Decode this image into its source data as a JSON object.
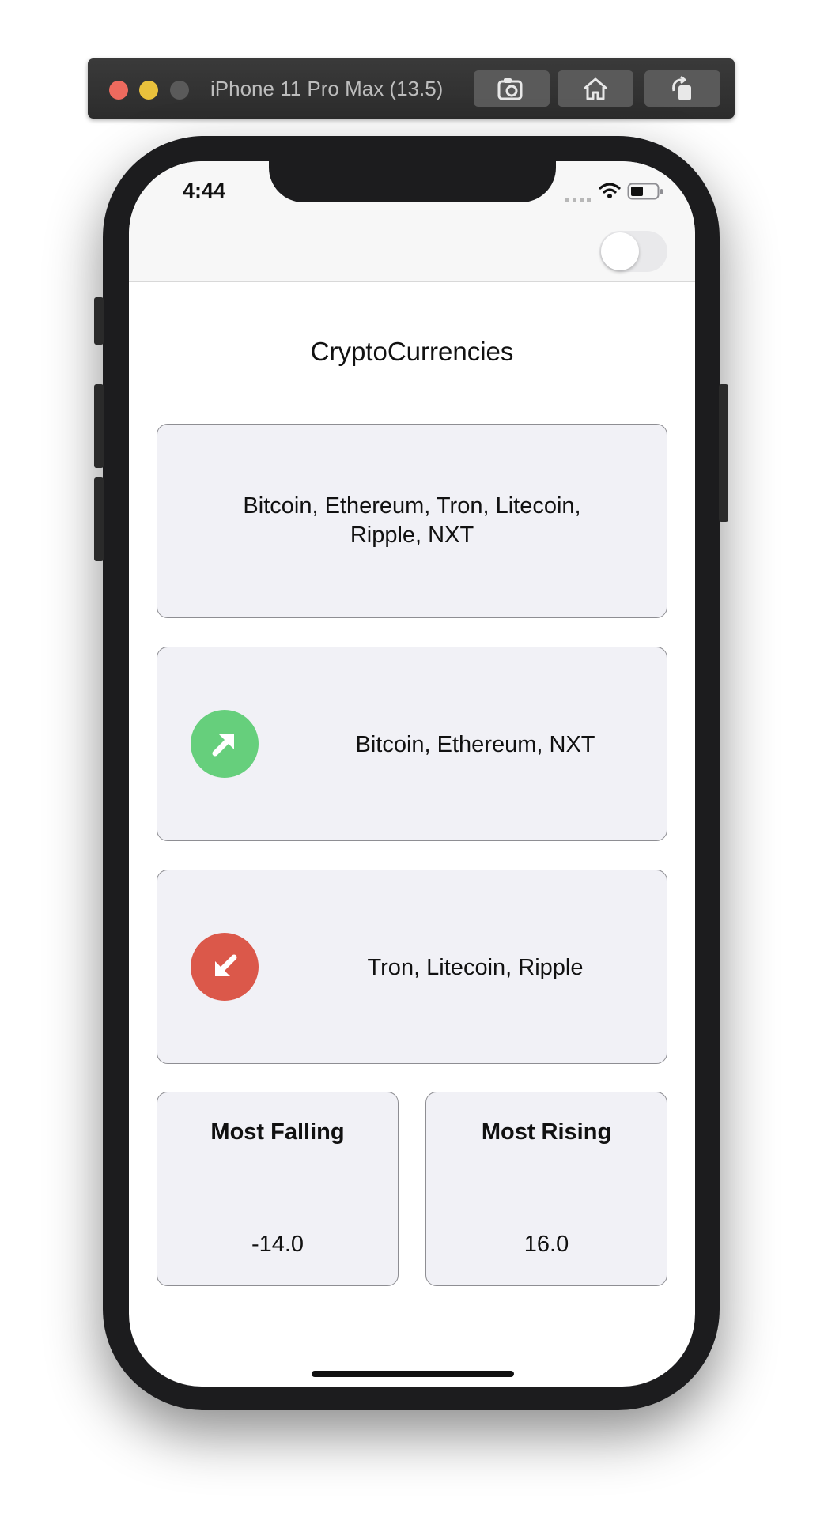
{
  "simulator": {
    "window_title": "iPhone 11 Pro Max (13.5)",
    "buttons": [
      "screenshot-icon",
      "home-icon",
      "rotate-icon"
    ]
  },
  "status_bar": {
    "time": "4:44"
  },
  "toggle": {
    "on": false
  },
  "page": {
    "title": "CryptoCurrencies"
  },
  "cards": {
    "all": {
      "text": "Bitcoin, Ethereum, Tron, Litecoin, Ripple, NXT"
    },
    "rising": {
      "icon": "arrow-up-right-icon",
      "text": "Bitcoin, Ethereum, NXT",
      "color": "#66cf7c"
    },
    "falling": {
      "icon": "arrow-down-left-icon",
      "text": "Tron, Litecoin, Ripple",
      "color": "#db584a"
    }
  },
  "stats": {
    "most_falling": {
      "label": "Most Falling",
      "value": "-14.0"
    },
    "most_rising": {
      "label": "Most Rising",
      "value": "16.0"
    }
  },
  "colors": {
    "card_bg": "#f1f1f6",
    "card_border": "#8e8e93",
    "rising": "#66cf7c",
    "falling": "#db584a"
  }
}
